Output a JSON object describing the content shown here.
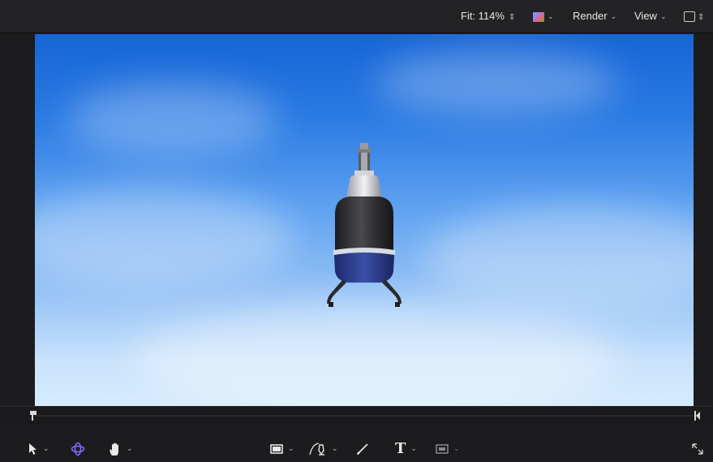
{
  "toolbar": {
    "fit_label": "Fit: 114%",
    "render_label": "Render",
    "view_label": "View"
  },
  "icons": {
    "color_channels": "color-swatch-icon",
    "overlay_toggle": "checkbox-icon",
    "select_tool": "arrow-pointer-icon",
    "3d_transform_tool": "orbit-icon",
    "pan_tool": "hand-icon",
    "shape_tool": "rectangle-icon",
    "bezier_tool": "pen-icon",
    "paint_tool": "brush-icon",
    "text_tool": "text-icon",
    "mask_tool": "mask-icon",
    "expand": "expand-arrows-icon",
    "play_in": "play-range-in-icon",
    "play_out": "play-range-out-icon"
  },
  "colors": {
    "accent_3d_tool": "#7b6cff",
    "sky_top": "#1665d6",
    "sky_bottom": "#d6ebfd"
  }
}
